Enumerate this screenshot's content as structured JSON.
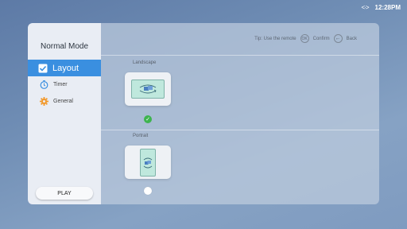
{
  "status_bar": {
    "network_icon": "<·>",
    "time": "12:28PM"
  },
  "sidebar": {
    "title": "Normal Mode",
    "items": [
      {
        "label": "Layout",
        "icon": "checkbox-icon",
        "active": true
      },
      {
        "label": "Timer",
        "icon": "timer-icon",
        "active": false
      },
      {
        "label": "General",
        "icon": "gear-icon",
        "active": false
      }
    ],
    "play_label": "PLAY"
  },
  "tip": {
    "text": "Tip: Use the remote",
    "ok_key": "OK",
    "confirm": "Confirm",
    "back": "Back"
  },
  "options": [
    {
      "label": "Landscape",
      "selected": true
    },
    {
      "label": "Portrait",
      "selected": false
    }
  ],
  "colors": {
    "accent": "#3a8fe0",
    "selected_check": "#3eb44f",
    "timer": "#3a8fe0",
    "gear": "#f29a2e"
  }
}
